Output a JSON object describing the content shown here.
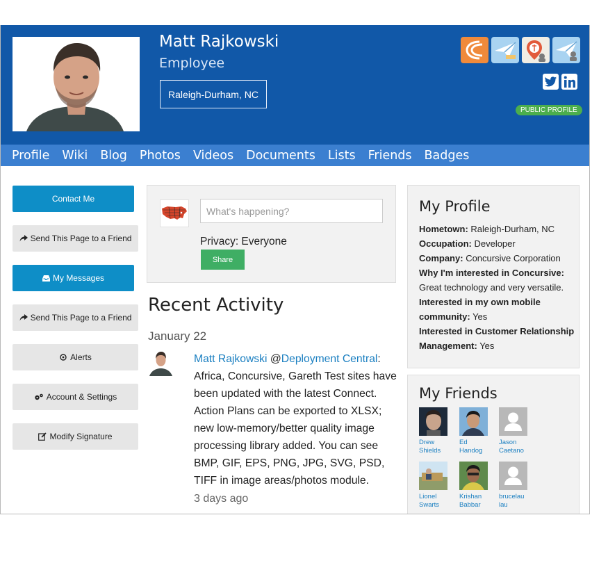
{
  "profile": {
    "name": "Matt Rajkowski",
    "role": "Employee",
    "location": "Raleigh-Durham, NC",
    "public_label": "PUBLIC PROFILE"
  },
  "badges": [
    {
      "name": "concursive-badge",
      "color": "#f08a3b"
    },
    {
      "name": "paper-plane-badge",
      "color": "#8ec3ea"
    },
    {
      "name": "location-badge",
      "color": "#f1ede4"
    },
    {
      "name": "paper-plane-user-badge",
      "color": "#8ec3ea"
    }
  ],
  "social": [
    {
      "icon": "twitter-icon"
    },
    {
      "icon": "linkedin-icon"
    }
  ],
  "nav": [
    "Profile",
    "Wiki",
    "Blog",
    "Photos",
    "Videos",
    "Documents",
    "Lists",
    "Friends",
    "Badges"
  ],
  "sidebar": {
    "contact": "Contact Me",
    "send_friend": "Send This Page to a Friend",
    "messages": "My Messages",
    "send_friend_2": "Send This Page to a Friend",
    "alerts": "Alerts",
    "account": "Account & Settings",
    "signature": "Modify Signature"
  },
  "composer": {
    "placeholder": "What's happening?",
    "privacy": "Privacy: Everyone",
    "share": "Share"
  },
  "activity": {
    "title": "Recent Activity",
    "date": "January 22",
    "author": "Matt Rajkowski",
    "at": "@",
    "target": "Deployment Central",
    "message": ": Africa, Concursive, Gareth Test sites have been updated with the latest Connect. Action Plans can be exported to XLSX; new low-memory/better quality image processing library added. You can see BMP, GIF, EPS, PNG, JPG, SVG, PSD, TIFF in image areas/photos module.",
    "time": "3 days ago"
  },
  "my_profile": {
    "title": "My Profile",
    "hometown_label": "Hometown:",
    "hometown": "Raleigh-Durham, NC",
    "occupation_label": "Occupation:",
    "occupation": "Developer",
    "company_label": "Company:",
    "company": "Concursive Corporation",
    "why_label": "Why I'm interested in Concursive:",
    "why": "Great technology and very versatile.",
    "mobile_label": "Interested in my own mobile community:",
    "mobile": "Yes",
    "crm_label": "Interested in Customer Relationship Management:",
    "crm": "Yes"
  },
  "friends": {
    "title": "My Friends",
    "list": [
      {
        "first": "Drew",
        "last": "Shields"
      },
      {
        "first": "Ed",
        "last": "Handog"
      },
      {
        "first": "Jason",
        "last": "Caetano"
      },
      {
        "first": "Lionel",
        "last": "Swarts"
      },
      {
        "first": "Krishan",
        "last": "Babbar"
      },
      {
        "first": "brucelau",
        "last": "lau"
      }
    ]
  }
}
